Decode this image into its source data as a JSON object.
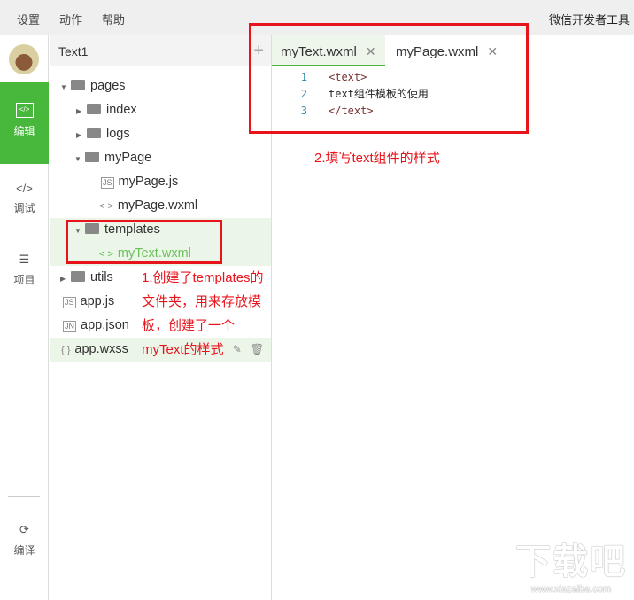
{
  "menubar": {
    "items": [
      "设置",
      "动作",
      "帮助"
    ],
    "app_title": "微信开发者工具"
  },
  "leftnav": {
    "items": [
      {
        "label": "编辑",
        "icon": "code-icon"
      },
      {
        "label": "调试",
        "icon": "debug-icon"
      },
      {
        "label": "项目",
        "icon": "menu-icon"
      },
      {
        "label": "编译",
        "icon": "compile-icon"
      }
    ]
  },
  "tree": {
    "project": "Text1",
    "rows": [
      {
        "label": "pages",
        "type": "folder-open"
      },
      {
        "label": "index",
        "type": "folder"
      },
      {
        "label": "logs",
        "type": "folder"
      },
      {
        "label": "myPage",
        "type": "folder-open"
      },
      {
        "label": "myPage.js",
        "type": "js",
        "icon_text": "JS"
      },
      {
        "label": "myPage.wxml",
        "type": "wxml",
        "icon_text": "< >"
      },
      {
        "label": "templates",
        "type": "folder-open"
      },
      {
        "label": "myText.wxml",
        "type": "wxml",
        "icon_text": "< >"
      },
      {
        "label": "utils",
        "type": "folder"
      },
      {
        "label": "app.js",
        "type": "js",
        "icon_text": "JS"
      },
      {
        "label": "app.json",
        "type": "json",
        "icon_text": "JN"
      },
      {
        "label": "app.wxss",
        "type": "wxss",
        "icon_text": "{ }"
      }
    ]
  },
  "editor": {
    "tabs": [
      {
        "label": "myText.wxml",
        "active": true
      },
      {
        "label": "myPage.wxml",
        "active": false
      }
    ],
    "lines": [
      {
        "n": "1",
        "text": "<text>"
      },
      {
        "n": "2",
        "text": "text组件模板的使用"
      },
      {
        "n": "3",
        "text": "</text>"
      }
    ]
  },
  "annotations": {
    "note1": [
      "1.创建了templates的",
      "文件夹，用来存放模",
      "板，创建了一个",
      "myText的样式"
    ],
    "note2": "2.填写text组件的样式"
  },
  "colors": {
    "accent": "#48b83c",
    "annotation": "#e8141c"
  },
  "watermark": {
    "big": "下载吧",
    "small": "www.xiazaiba.com"
  }
}
